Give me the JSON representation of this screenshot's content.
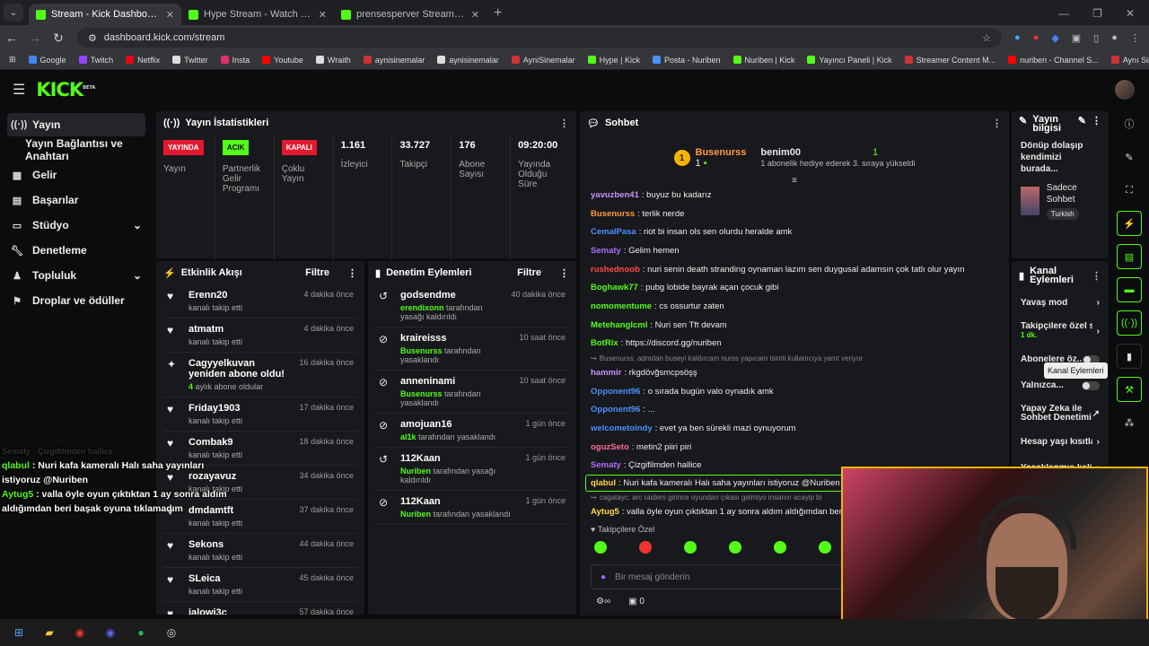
{
  "browser": {
    "tabs": [
      {
        "title": "Stream - Kick Dashboard",
        "active": true
      },
      {
        "title": "Hype Stream - Watch Live on Ki",
        "active": false
      },
      {
        "title": "prensesperver Stream - Watch L",
        "active": false
      }
    ],
    "url": "dashboard.kick.com/stream",
    "bookmarks": [
      "Google",
      "Twitch",
      "Netflix",
      "Twitter",
      "Insta",
      "Youtube",
      "Wraith",
      "aynisinemalar",
      "aynisinemalar",
      "AyniSinemalar",
      "Hype | Kick",
      "Posta - Nuriben",
      "Nuriben | Kick",
      "Yayıncı Paneli | Kick",
      "Streamer Content M...",
      "nuriben - Channel S...",
      "Aynı Sinemalar - Ça..."
    ]
  },
  "header": {
    "logo": "KICK",
    "beta": "BETA"
  },
  "sidebar": {
    "items": [
      {
        "label": "Yayın",
        "icon": "broadcast-icon",
        "active": true
      },
      {
        "label": "Yayın Bağlantısı ve Anahtarı",
        "sub": true
      },
      {
        "label": "Gelir",
        "icon": "revenue-icon"
      },
      {
        "label": "Başarılar",
        "icon": "achievements-icon"
      },
      {
        "label": "Stüdyo",
        "icon": "studio-icon",
        "chevron": true
      },
      {
        "label": "Denetleme",
        "icon": "wrench-icon"
      },
      {
        "label": "Topluluk",
        "icon": "community-icon",
        "chevron": true
      },
      {
        "label": "Droplar ve ödüller",
        "icon": "drops-icon"
      }
    ]
  },
  "stats": {
    "title": "Yayın İstatistikleri",
    "items": [
      {
        "badge": "YAYINDA",
        "badge_color": "#e3192f",
        "label": "Yayın"
      },
      {
        "badge": "ACIK",
        "badge_color": "#53fc18",
        "label": "Partnerlik Gelir Programı"
      },
      {
        "badge": "KAPALI",
        "badge_color": "#e3192f",
        "label": "Çoklu Yayın"
      },
      {
        "value": "1.161",
        "label": "İzleyici"
      },
      {
        "value": "33.727",
        "label": "Takipçi"
      },
      {
        "value": "176",
        "label": "Abone Sayısı"
      },
      {
        "value": "09:20:00",
        "label": "Yayında Olduğu Süre"
      }
    ]
  },
  "activity": {
    "title": "Etkinlik Akışı",
    "filter": "Filtre",
    "items": [
      {
        "name": "Erenn20",
        "desc": "kanalı takip etti",
        "time": "4 dakika önce",
        "icon": "heart-icon"
      },
      {
        "name": "atmatm",
        "desc": "kanalı takip etti",
        "time": "4 dakika önce",
        "icon": "heart-icon"
      },
      {
        "name": "Cagyyelkuvan yeniden abone oldu!",
        "desc_pre": "4",
        "desc": " aylık abone oldular",
        "time": "16 dakika önce",
        "icon": "sparkle-icon"
      },
      {
        "name": "Friday1903",
        "desc": "kanalı takip etti",
        "time": "17 dakika önce",
        "icon": "heart-icon"
      },
      {
        "name": "Combak9",
        "desc": "kanalı takip etti",
        "time": "18 dakika önce",
        "icon": "heart-icon"
      },
      {
        "name": "rozayavuz",
        "desc": "kanalı takip etti",
        "time": "34 dakika önce",
        "icon": "heart-icon"
      },
      {
        "name": "dmdamtft",
        "desc": "kanalı takip etti",
        "time": "37 dakika önce",
        "icon": "heart-icon"
      },
      {
        "name": "Sekons",
        "desc": "kanalı takip etti",
        "time": "44 dakika önce",
        "icon": "heart-icon"
      },
      {
        "name": "SLeica",
        "desc": "kanalı takip etti",
        "time": "45 dakika önce",
        "icon": "heart-icon"
      },
      {
        "name": "jalowi3c",
        "desc": "kanalı takip etti",
        "time": "57 dakika önce",
        "icon": "heart-icon"
      }
    ]
  },
  "moderation": {
    "title": "Denetim Eylemleri",
    "filter": "Filtre",
    "items": [
      {
        "name": "godsendme",
        "by": "erendixonn",
        "desc": " tarafından yasağı kaldırıldı",
        "time": "40 dakika önce",
        "icon": "undo-icon"
      },
      {
        "name": "kraireisss",
        "by": "Busenurss",
        "desc": " tarafından yasaklandı",
        "time": "10 saat önce",
        "icon": "ban-icon"
      },
      {
        "name": "anneninami",
        "by": "Busenurss",
        "desc": " tarafından yasaklandı",
        "time": "10 saat önce",
        "icon": "ban-icon"
      },
      {
        "name": "amojuan16",
        "by": "al1k",
        "desc": " tarafından yasaklandı",
        "time": "1 gün önce",
        "icon": "ban-icon"
      },
      {
        "name": "112Kaan",
        "by": "Nuriben",
        "desc": " tarafından yasağı kaldırıldı",
        "time": "1 gün önce",
        "icon": "undo-icon"
      },
      {
        "name": "112Kaan",
        "by": "Nuriben",
        "desc": " tarafından yasaklandı",
        "time": "1 gün önce",
        "icon": "ban-icon"
      }
    ]
  },
  "chat": {
    "title": "Sohbet",
    "gift": {
      "left_name": "Busenurss",
      "left_count": "1",
      "right_name": "benim00",
      "right_count": "1",
      "rank": "1",
      "sub": "1 abonelik hediye ederek 3. sıraya yükseldi"
    },
    "messages": [
      {
        "user": "yavuzben41",
        "color": "#c792ff",
        "text": ": buyuz bu kadarız"
      },
      {
        "user": "Busenurss",
        "color": "#ff9a3c",
        "text": ": terlik nerde"
      },
      {
        "user": "CemalPasa",
        "color": "#4a90ff",
        "text": ": riot bi insan ols sen olurdu heralde amk"
      },
      {
        "user": "Sematy",
        "color": "#b06cff",
        "text": ": Gelim hemen"
      },
      {
        "user": "rushednoob",
        "color": "#ff4b4b",
        "text": ": nuri senin death stranding oynaman lazım sen duygusal adamsın çok tatlı olur yayın"
      },
      {
        "user": "Boghawk77",
        "color": "#53fc18",
        "text": ": pubg lobide bayrak açan çocuk gibi"
      },
      {
        "user": "nomomentume",
        "color": "#53fc18",
        "text": ": cs ossurtur zaten"
      },
      {
        "user": "Metehanglcml",
        "color": "#53fc18",
        "text": ": Nuri sen Tft devam"
      },
      {
        "user": "BotRix",
        "color": "#53fc18",
        "text": ": https://discord.gg/nuriben"
      },
      {
        "reply": "Busenurss: admdan buseyi kaldırcam nurss yapıcam isimli kullanıcıya yanıt veriyor"
      },
      {
        "user": "hammir",
        "color": "#c792ff",
        "text": ": rkgdövğsmcpsöşş"
      },
      {
        "user": "Opponent96",
        "color": "#4a90ff",
        "text": ": o sırada bugün valo oynadık amk"
      },
      {
        "user": "Opponent96",
        "color": "#4a90ff",
        "text": ": ..."
      },
      {
        "user": "welcometoindy",
        "color": "#4a90ff",
        "text": ": evet ya ben sürekli mazi oynuyorum"
      },
      {
        "user": "oguzSeto",
        "color": "#ff6b9a",
        "text": ": metin2 piiri piri"
      },
      {
        "user": "Sematy",
        "color": "#b06cff",
        "text": ": Çizgifilmden hallice"
      },
      {
        "user": "qlabul",
        "color": "#ffd84a",
        "text": ": Nuri kafa kameralı Halı saha yayınları istiyoruz @Nuriben",
        "highlight": true
      },
      {
        "reply": "cagatayc: arc raiders girince oyundan çıkası gelmiyo insanın acayip bi"
      },
      {
        "user": "Aytug5",
        "color": "#ffd84a",
        "text": ": valla öyle oyun çıktıktan 1 ay sonra aldım aldığımdan beri ba"
      }
    ],
    "followers_only": "Takipçilere Özel",
    "placeholder": "Bir mesaj gönderin",
    "footer_count": "0"
  },
  "stream_info": {
    "title": "Yayın bilgisi",
    "stream_title": "Dönüp dolaşıp kendimizi burada...",
    "category": "Sadece Sohbet",
    "language": "Turkish"
  },
  "channel_actions": {
    "title": "Kanal Eylemleri",
    "items": [
      {
        "label": "Yavaş mod",
        "type": "chevron"
      },
      {
        "label": "Takipçilere özel s",
        "sub": "1 dk.",
        "type": "chevron"
      },
      {
        "label": "Abonelere öz...",
        "type": "toggle"
      },
      {
        "label": "Yalnızca...",
        "type": "toggle"
      },
      {
        "label": "Yapay Zeka ile Sohbet Denetimi",
        "type": "external"
      },
      {
        "label": "Hesap yaşı kısıtla",
        "type": "chevron"
      },
      {
        "label": "Yasaklanmış kelim",
        "type": "chevron"
      }
    ],
    "tooltip": "Kanal Eylemleri"
  },
  "overlay": {
    "ghost": "Sematy : Çizgifilmden hallice",
    "lines": [
      {
        "user": "qlabul",
        "text": " : Nuri kafa kameralı Halı saha yayınları istiyoruz @Nuriben"
      },
      {
        "user": "Aytug5",
        "text": " : valla öyle oyun çıktıktan 1 ay sonra aldım aldığımdan beri başak oyuna tıklamadım"
      }
    ]
  },
  "colors": {
    "accent": "#53fc18",
    "live": "#e3192f",
    "webcam_border": "#f5b400"
  }
}
